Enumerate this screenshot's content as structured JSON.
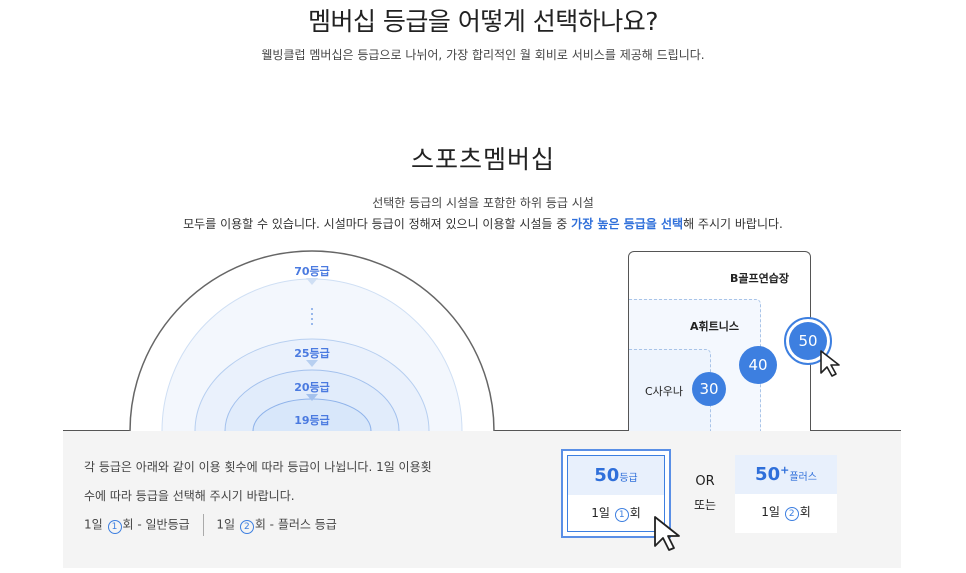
{
  "header": {
    "title": "멤버십 등급을 어떻게 선택하나요?",
    "subtitle": "웰빙클럽 멤버십은 등급으로 나뉘어, 가장 합리적인 월 회비로 서비스를 제공해 드립니다."
  },
  "section": {
    "title": "스포츠멤버십",
    "desc_line1": "선택한 등급의 시설을 포함한 하위 등급 시설",
    "desc_line2_pre": "모두를 이용할 수 있습니다. 시설마다 등급이 정해져 있으니 이용할 시설들 중 ",
    "desc_line2_highlight": "가장 높은 등급을 선택",
    "desc_line2_post": "해 주시기 바랍니다."
  },
  "arch": {
    "top_label": "70등급",
    "dots": "⋮",
    "labels": [
      "25등급",
      "20등급",
      "19등급"
    ]
  },
  "facilities": {
    "b_label": "B골프연습장",
    "a_label": "A휘트니스",
    "c_label": "C사우나",
    "grades": [
      "30",
      "40",
      "50"
    ]
  },
  "notes": {
    "line1": "각 등급은 아래와 같이 이용 횟수에 따라 등급이 나뉩니다. 1일 이용횟",
    "line2": "수에 따라 등급을 선택해 주시기 바랍니다.",
    "line3_a_pre": "1일 ",
    "line3_a_circ": "1",
    "line3_a_post": "회 - 일반등급",
    "line3_b_pre": "1일 ",
    "line3_b_circ": "2",
    "line3_b_post": "회 - 플러스 등급"
  },
  "cards": {
    "left_grade": "50",
    "left_suffix": "등급",
    "left_usage_pre": "1일 ",
    "left_usage_circ": "1",
    "left_usage_post": "회",
    "or_en": "OR",
    "or_ko": "또는",
    "right_grade": "50",
    "right_sup": "+",
    "right_suffix": "플러스",
    "right_usage_pre": "1일 ",
    "right_usage_circ": "2",
    "right_usage_post": "회"
  },
  "colors": {
    "accent": "#3d7fe0",
    "highlight": "#2f6fda",
    "panel": "#f4f4f4"
  },
  "icons": [
    "pointer-cursor-icon"
  ]
}
